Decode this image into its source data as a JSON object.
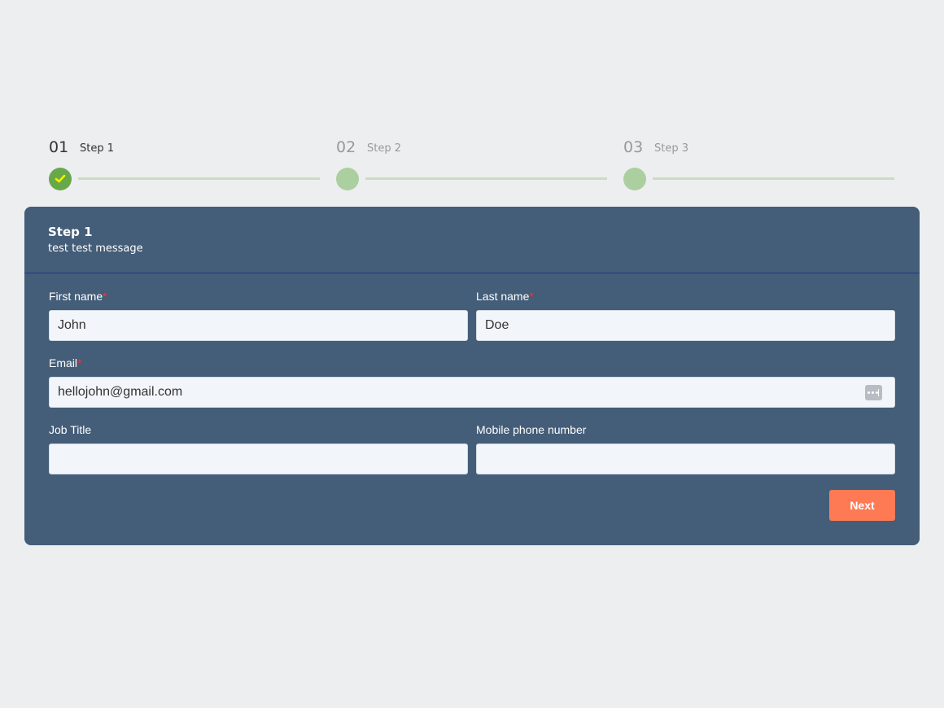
{
  "stepper": {
    "steps": [
      {
        "number": "01",
        "label": "Step 1",
        "state": "completed"
      },
      {
        "number": "02",
        "label": "Step 2",
        "state": "pending"
      },
      {
        "number": "03",
        "label": "Step 3",
        "state": "pending"
      }
    ],
    "icons": {
      "completed": "check-icon"
    }
  },
  "card": {
    "title": "Step 1",
    "subtitle": "test test message"
  },
  "form": {
    "first_name": {
      "label": "First name",
      "required_mark": "*",
      "value": "John"
    },
    "last_name": {
      "label": "Last name",
      "required_mark": "*",
      "value": "Doe"
    },
    "email": {
      "label": "Email",
      "required_mark": "*",
      "value": "hellojohn@gmail.com",
      "icon": "password-manager-icon"
    },
    "job_title": {
      "label": "Job Title",
      "value": ""
    },
    "mobile": {
      "label": "Mobile phone number",
      "value": ""
    },
    "next_label": "Next"
  },
  "colors": {
    "card_bg": "#445d78",
    "accent_button": "#fd7a55",
    "step_active": "#68a84a",
    "step_pending": "#accfa0",
    "required": "#e53b3b"
  }
}
